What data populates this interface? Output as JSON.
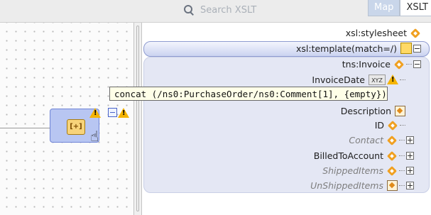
{
  "toolbar": {
    "search_placeholder": "Search XSLT",
    "tabs": [
      {
        "label": "Map",
        "active": true
      },
      {
        "label": "XSLT",
        "active": false
      }
    ]
  },
  "tree": {
    "rows": [
      {
        "label": "xsl:stylesheet",
        "icon": "stylesheet-icon",
        "style": "plain"
      },
      {
        "label": "xsl:template(match=/)",
        "icon": "template-icon",
        "style": "highlight"
      },
      {
        "label": "tns:Invoice",
        "icon": "element-icon",
        "style": "band"
      },
      {
        "label": "InvoiceDate",
        "icon": "xyz-function-icon",
        "style": "band"
      },
      {
        "label": "Description",
        "icon": "box-element-icon",
        "style": "band"
      },
      {
        "label": "ID",
        "icon": "element-icon",
        "style": "band"
      },
      {
        "label": "Contact",
        "icon": "complex-element-icon",
        "style": "band-italic"
      },
      {
        "label": "BilledToAccount",
        "icon": "element-icon",
        "style": "band"
      },
      {
        "label": "ShippedItems",
        "icon": "element-icon",
        "style": "band-italic"
      },
      {
        "label": "UnShippedItems",
        "icon": "box-element-icon",
        "style": "band-italic"
      }
    ]
  },
  "tooltip": {
    "text": "concat (/ns0:PurchaseOrder/ns0:Comment[1], {empty})"
  },
  "canvas": {
    "function_node_label": "concat"
  },
  "colors": {
    "accent": "#6f84d6",
    "warning": "#f5b400",
    "element_icon": "#f0a020"
  }
}
